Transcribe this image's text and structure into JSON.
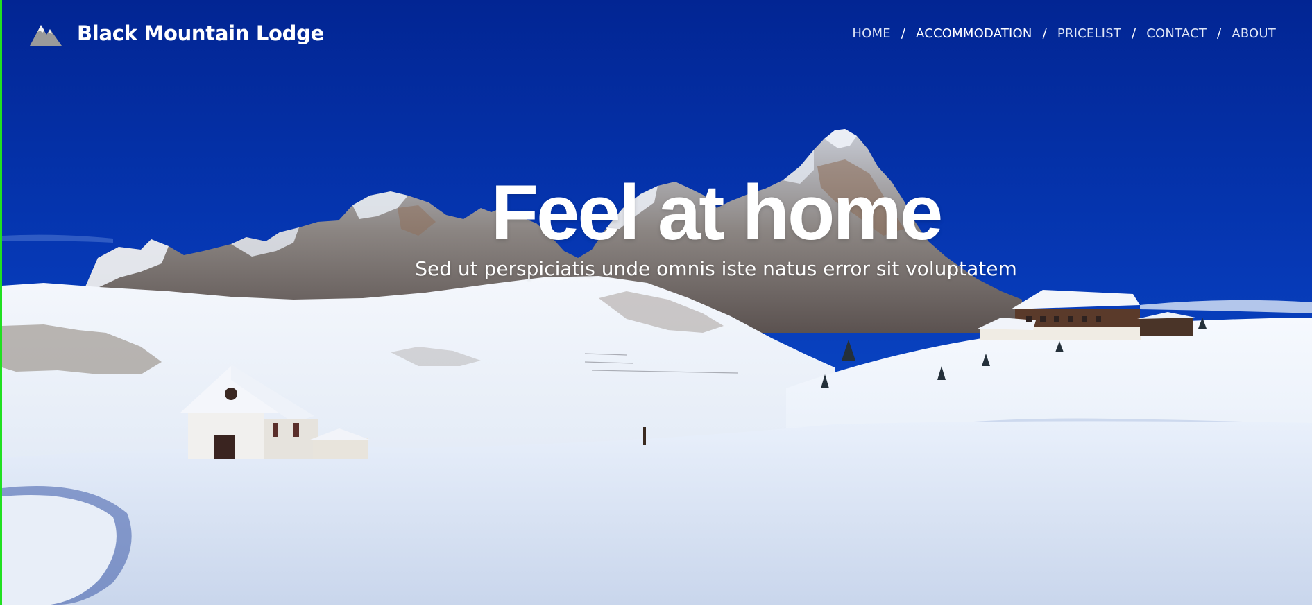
{
  "brand": {
    "name": "Black Mountain Lodge",
    "logo_icon": "mountain-icon"
  },
  "nav": {
    "items": [
      {
        "label": "HOME",
        "active": false
      },
      {
        "label": "ACCOMMODATION",
        "active": true
      },
      {
        "label": "PRICELIST",
        "active": false
      },
      {
        "label": "CONTACT",
        "active": false
      },
      {
        "label": "ABOUT",
        "active": false
      }
    ],
    "separator": "/"
  },
  "hero": {
    "title": "Feel at home",
    "subtitle": "Sed ut perspiciatis unde omnis iste natus error sit voluptatem",
    "background": "snowy-mountain-landscape-image"
  },
  "colors": {
    "sky_top": "#022a98",
    "sky_bottom": "#0a4ed0",
    "snow": "#e8eef8",
    "accent_border": "#21e021",
    "text": "#ffffff"
  }
}
